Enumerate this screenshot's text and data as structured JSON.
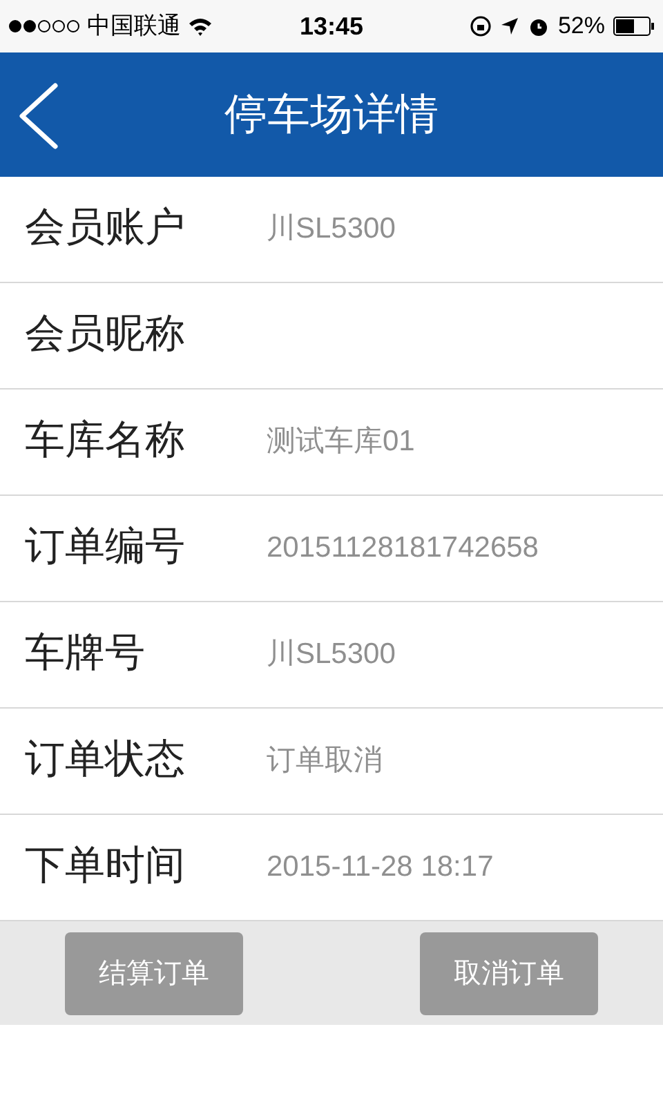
{
  "status_bar": {
    "carrier": "中国联通",
    "time": "13:45",
    "battery": "52%"
  },
  "header": {
    "title": "停车场详情"
  },
  "fields": [
    {
      "label": "会员账户",
      "value": "川SL5300"
    },
    {
      "label": "会员昵称"
    },
    {
      "label": "车库名称",
      "value": "测试车库01"
    },
    {
      "label": "订单编号",
      "value": "20151128181742658"
    },
    {
      "label": "车牌号",
      "value": "川SL5300"
    },
    {
      "label": "订单状态",
      "value": "订单取消"
    },
    {
      "label": "下单时间",
      "value": "2015-11-28 18:17"
    }
  ],
  "buttons": [
    "结算订单",
    "取消订单"
  ]
}
